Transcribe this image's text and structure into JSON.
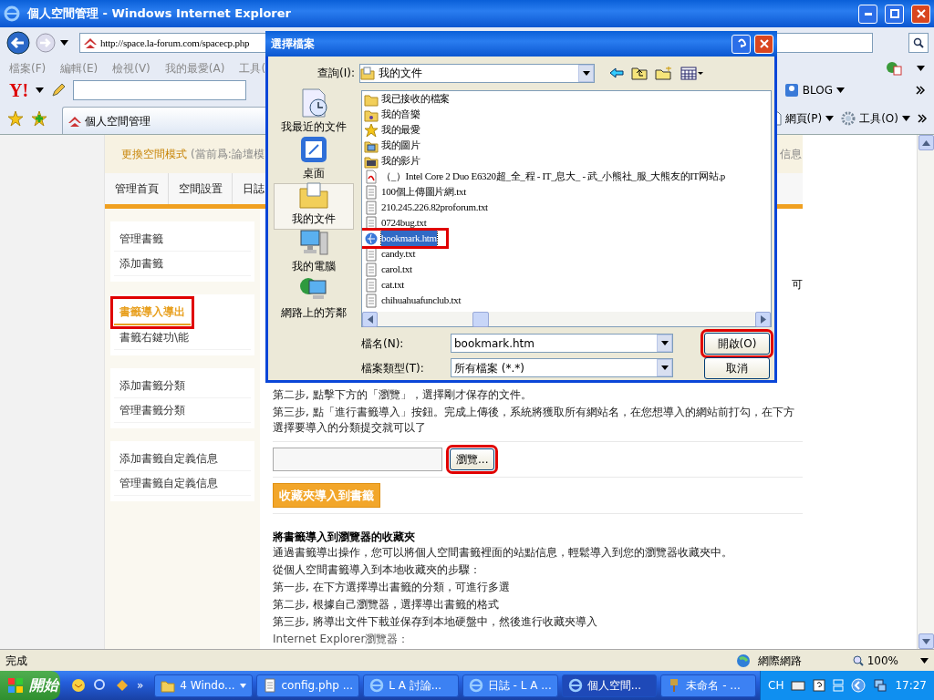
{
  "browser": {
    "title": "個人空間管理 - Windows Internet Explorer",
    "address": "http://space.la-forum.com/spacecp.php",
    "menu": [
      "檔案(F)",
      "編輯(E)",
      "檢視(V)",
      "我的最愛(A)",
      "工具("
    ],
    "search_logo": "Y!",
    "toolbar_button": "BLOG",
    "tab": "個人空間管理",
    "command_buttons": [
      "網頁(P)",
      "工具(O)"
    ]
  },
  "page": {
    "mode_link": "更換空間模式",
    "mode_note": "(當前爲:論壇模",
    "header_right": "信息",
    "nav_tabs": [
      "管理首頁",
      "空間設置",
      "日誌"
    ],
    "sidebar": [
      {
        "items": [
          {
            "label": "管理書籤",
            "selected": false,
            "highlighted": false
          },
          {
            "label": "添加書籤",
            "selected": false,
            "highlighted": false
          }
        ]
      },
      {
        "items": [
          {
            "label": "書籤導入導出",
            "selected": true,
            "highlighted": true
          },
          {
            "label": "書籤右鍵功\\能",
            "selected": false,
            "highlighted": false
          }
        ]
      },
      {
        "items": [
          {
            "label": "添加書籤分類",
            "selected": false,
            "highlighted": false
          },
          {
            "label": "管理書籤分類",
            "selected": false,
            "highlighted": false
          }
        ]
      },
      {
        "items": [
          {
            "label": "添加書籤自定義信息",
            "selected": false,
            "highlighted": false
          },
          {
            "label": "管理書籤自定義信息",
            "selected": false,
            "highlighted": false
          }
        ]
      }
    ],
    "fragment": "可",
    "import_steps": [
      "第二步, 點擊下方的「瀏覽」，選擇剛才保存的文件。",
      "第三步, 點「進行書籤導入」按鈕。完成上傳後，系統將獲取所有網站名，在您想導入的網站前打勾，在下方選擇要導入的分類提交就可以了"
    ],
    "browse_button": {
      "label": "瀏覽...",
      "highlighted": true
    },
    "import_button": "收藏夾導入到書籤",
    "export_heading": "將書籤導入到瀏覽器的收藏夾",
    "export_lines": [
      "通過書籤導出操作，您可以將個人空間書籤裡面的站點信息，輕鬆導入到您的瀏覽器收藏夾中。",
      "從個人空間書籤導入到本地收藏夾的步驟：",
      "第一步, 在下方選擇導出書籤的分類，可進行多選",
      "第二步, 根據自己瀏覽器，選擇導出書籤的格式",
      "第三步, 將導出文件下載並保存到本地硬盤中，然後進行收藏夾導入",
      "Internet Explorer瀏覽器："
    ]
  },
  "status_bar": {
    "text": "完成",
    "zone": "網際網路",
    "zoom": "100%"
  },
  "dialog": {
    "title": "選擇檔案",
    "look_in_label": "查詢(I):",
    "look_in": "我的文件",
    "places": [
      {
        "label": "我最近的文件",
        "kind": "recent",
        "selected": false
      },
      {
        "label": "桌面",
        "kind": "desktop",
        "selected": false
      },
      {
        "label": "我的文件",
        "kind": "documents",
        "selected": true
      },
      {
        "label": "我的電腦",
        "kind": "computer",
        "selected": false
      },
      {
        "label": "網路上的芳鄰",
        "kind": "network",
        "selected": false
      }
    ],
    "files": [
      {
        "name": "我已接收的檔案",
        "kind": "folder",
        "selected": false,
        "highlighted": false
      },
      {
        "name": "我的音樂",
        "kind": "music",
        "selected": false,
        "highlighted": false
      },
      {
        "name": "我的最愛",
        "kind": "star",
        "selected": false,
        "highlighted": false
      },
      {
        "name": "我的圖片",
        "kind": "pictures",
        "selected": false,
        "highlighted": false
      },
      {
        "name": "我的影片",
        "kind": "video",
        "selected": false,
        "highlighted": false
      },
      {
        "name": "（_）Intel Core 2 Duo E6320超_全_程 - IT_息大_ - 武_小熊社_服_大熊友的IT网站.p",
        "kind": "pdf",
        "selected": false,
        "highlighted": false
      },
      {
        "name": "100個上傳圖片網.txt",
        "kind": "txt",
        "selected": false,
        "highlighted": false
      },
      {
        "name": "210.245.226.82proforum.txt",
        "kind": "txt",
        "selected": false,
        "highlighted": false
      },
      {
        "name": "0724bug.txt",
        "kind": "txt",
        "selected": false,
        "highlighted": false
      },
      {
        "name": "bookmark.htm",
        "kind": "htm",
        "selected": true,
        "highlighted": true
      },
      {
        "name": "candy.txt",
        "kind": "txt",
        "selected": false,
        "highlighted": false
      },
      {
        "name": "carol.txt",
        "kind": "txt",
        "selected": false,
        "highlighted": false
      },
      {
        "name": "cat.txt",
        "kind": "txt",
        "selected": false,
        "highlighted": false
      },
      {
        "name": "chihuahuafunclub.txt",
        "kind": "txt",
        "selected": false,
        "highlighted": false
      }
    ],
    "file_name_label": "檔名(N):",
    "file_name": "bookmark.htm",
    "file_type_label": "檔案類型(T):",
    "file_type": "所有檔案 (*.*)",
    "open_button": {
      "label": "開啟(O)",
      "highlighted": true
    },
    "cancel_button": "取消"
  },
  "taskbar": {
    "start": "開始",
    "overflow": "»",
    "tasks": [
      {
        "label": "4 Windo...",
        "kind": "folder",
        "selected": false
      },
      {
        "label": "config.php ...",
        "kind": "txt",
        "selected": false
      },
      {
        "label": "L A 討論...",
        "kind": "ie",
        "selected": false
      },
      {
        "label": "日誌 - L A ...",
        "kind": "ie",
        "selected": false
      },
      {
        "label": "個人空間...",
        "kind": "ie",
        "selected": true
      },
      {
        "label": "未命名 - ...",
        "kind": "paint",
        "selected": false
      }
    ],
    "language": "CH",
    "clock": "17:27"
  }
}
